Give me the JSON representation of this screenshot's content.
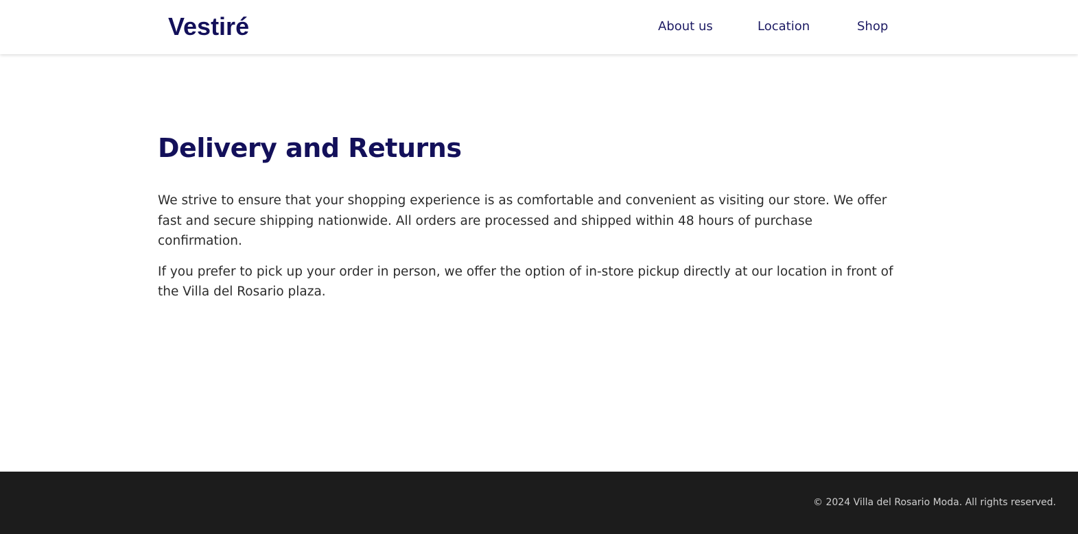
{
  "header": {
    "logo": "Vestiré",
    "nav": {
      "about": "About us",
      "location": "Location",
      "shop": "Shop"
    }
  },
  "main": {
    "title": "Delivery and Returns",
    "paragraphs": [
      "We strive to ensure that your shopping experience is as comfortable and convenient as visiting our store. We offer fast and secure shipping nationwide. All orders are processed and shipped within 48 hours of purchase confirmation.",
      "If you prefer to pick up your order in person, we offer the option of in-store pickup directly at our location in front of the Villa del Rosario plaza."
    ]
  },
  "footer": {
    "copyright": "© 2024 Villa del Rosario Moda. All rights reserved."
  },
  "colors": {
    "brand_navy": "#13105a",
    "body_text": "#2c2c2c",
    "footer_bg": "#1c1c1c",
    "footer_text": "#cfcfcf"
  }
}
